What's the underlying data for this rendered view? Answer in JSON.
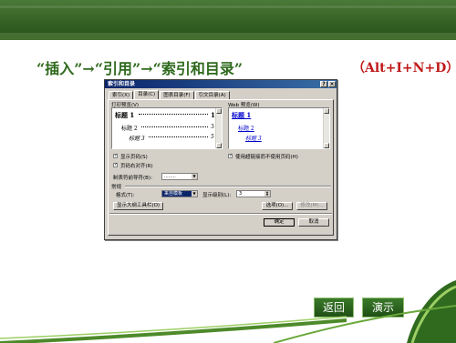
{
  "slide": {
    "instruction": "“插入”→“引用”→“索引和目录”",
    "shortcut": "（Alt+I+N+D）"
  },
  "dialog": {
    "title": "索引和目录",
    "tabs": [
      "索引(X)",
      "目录(C)",
      "图表目录(F)",
      "引文目录(A)"
    ],
    "print_preview_label": "打印预览(V)",
    "print_preview": [
      {
        "text": "标题 1",
        "page": "1"
      },
      {
        "text": "标题 2",
        "page": "3"
      },
      {
        "text": "标题 3",
        "page": "5"
      }
    ],
    "web_preview_label": "Web 预览(W)",
    "web_preview": [
      "标题 1",
      "标题 2",
      "标题 3"
    ],
    "show_page_numbers": "显示页码(S)",
    "right_align_page_numbers": "页码右对齐(R)",
    "tab_leader_label": "制表符前导符(B):",
    "tab_leader_value": "........",
    "use_hyperlinks": "使用超链接而不使用页码(H)",
    "general_label": "常规",
    "format_label": "格式(T):",
    "format_value": "来自模板",
    "levels_label": "显示级别(L):",
    "levels_value": "3",
    "outline_toolbar_button": "显示大纲工具栏(O)",
    "options_button": "选项(O)...",
    "modify_button": "修改(M)...",
    "ok_button": "确定",
    "cancel_button": "取消"
  },
  "nav": {
    "back_label": "返回",
    "demo_label": "演示"
  },
  "colors": {
    "header": "#2f5a20",
    "instruction": "#2f6a1e",
    "shortcut": "#c01a1a",
    "link": "#0000cc"
  }
}
